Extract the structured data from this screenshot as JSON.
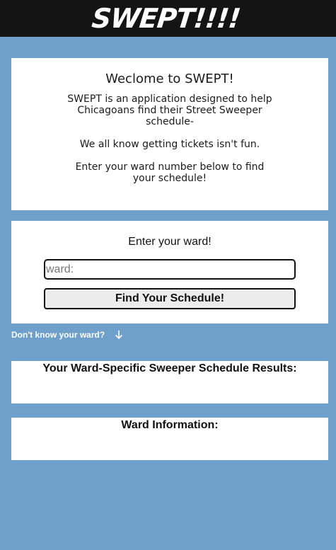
{
  "header": {
    "logo_text": "SWEPT!!!!"
  },
  "welcome": {
    "title": "Weclome to SWEPT!",
    "paragraph1": "SWEPT is an application designed to help Chicagoans find their Street Sweeper schedule-",
    "paragraph2": "We all know getting tickets isn't fun.",
    "paragraph3": "Enter your ward number below to find your schedule!"
  },
  "ward_form": {
    "title": "Enter your ward!",
    "input_placeholder": "ward:",
    "input_value": "",
    "button_label": "Find Your Schedule!"
  },
  "help_link": {
    "label": "Don't know your ward?",
    "icon": "arrow-down-icon"
  },
  "results": {
    "heading": "Your Ward-Specific Sweeper Schedule Results:"
  },
  "ward_info": {
    "heading": "Ward Information:"
  },
  "colors": {
    "background": "#6f9fcb",
    "header": "#141414",
    "card": "#ffffff",
    "button": "#ececec"
  }
}
